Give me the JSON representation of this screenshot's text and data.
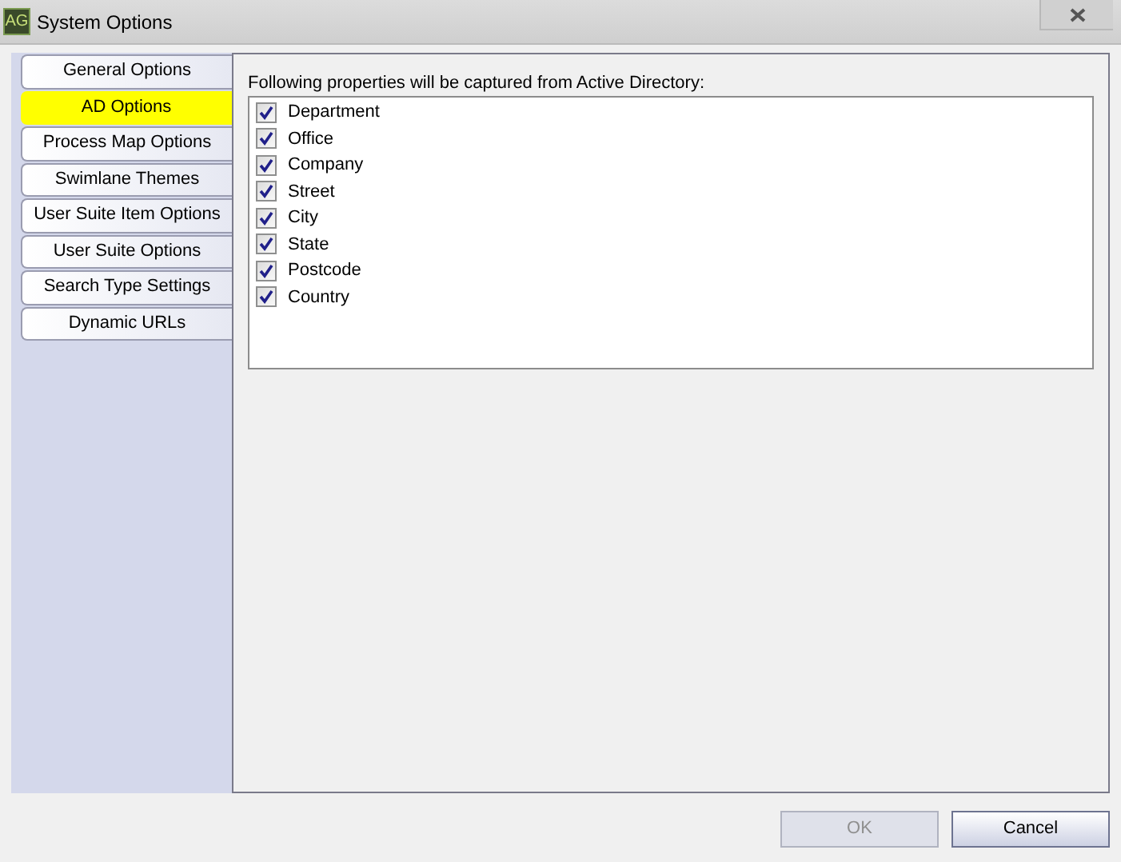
{
  "window": {
    "title": "System Options",
    "app_icon": "AG"
  },
  "tabs": [
    {
      "label": "General Options",
      "selected": false
    },
    {
      "label": "AD Options",
      "selected": true
    },
    {
      "label": "Process Map Options",
      "selected": false
    },
    {
      "label": "Swimlane Themes",
      "selected": false
    },
    {
      "label": "User Suite Item Options",
      "selected": false
    },
    {
      "label": "User Suite Options",
      "selected": false
    },
    {
      "label": "Search Type Settings",
      "selected": false
    },
    {
      "label": "Dynamic URLs",
      "selected": false
    }
  ],
  "caption": "Following properties will be captured from Active Directory:",
  "properties": [
    {
      "label": "Department",
      "checked": true
    },
    {
      "label": "Office",
      "checked": true
    },
    {
      "label": "Company",
      "checked": true
    },
    {
      "label": "Street",
      "checked": true
    },
    {
      "label": "City",
      "checked": true
    },
    {
      "label": "State",
      "checked": true
    },
    {
      "label": "Postcode",
      "checked": true
    },
    {
      "label": "Country",
      "checked": true
    }
  ],
  "buttons": [
    {
      "label": "OK",
      "disabled": true
    },
    {
      "label": "Cancel",
      "disabled": false
    }
  ]
}
